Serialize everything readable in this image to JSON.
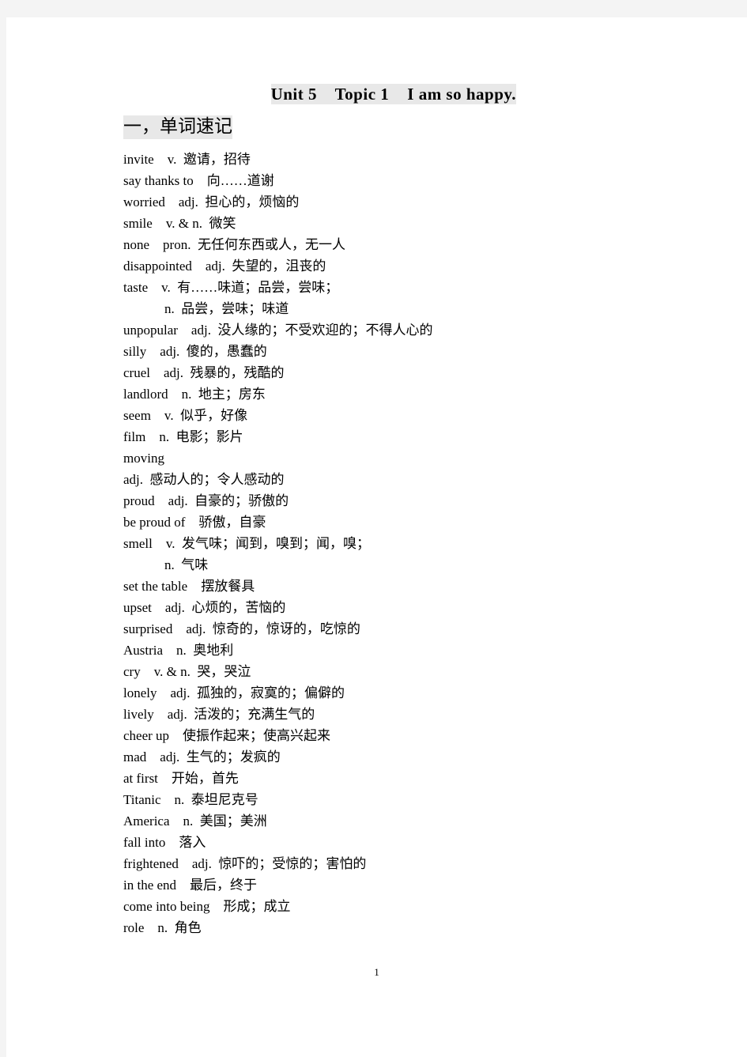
{
  "document": {
    "title": "Unit 5    Topic 1    I am so happy.",
    "section_heading": "一，单词速记",
    "page_number": "1",
    "highlight_color": "#e8e8e8",
    "page_background": "#ffffff",
    "canvas_background": "#f4f4f4"
  },
  "vocabulary": [
    {
      "text": "invite    v.  邀请，招待",
      "continuation": false
    },
    {
      "text": "say thanks to    向……道谢",
      "continuation": false
    },
    {
      "text": "worried    adj.  担心的，烦恼的",
      "continuation": false
    },
    {
      "text": "smile    v. & n.  微笑",
      "continuation": false
    },
    {
      "text": "none    pron.  无任何东西或人，无一人",
      "continuation": false
    },
    {
      "text": "disappointed    adj.  失望的，沮丧的",
      "continuation": false
    },
    {
      "text": "taste    v.  有……味道；品尝，尝味；",
      "continuation": false
    },
    {
      "text": "n.  品尝，尝味；味道",
      "continuation": true
    },
    {
      "text": "unpopular    adj.  没人缘的；不受欢迎的；不得人心的",
      "continuation": false
    },
    {
      "text": "silly    adj.  傻的，愚蠢的",
      "continuation": false
    },
    {
      "text": "cruel    adj.  残暴的，残酷的",
      "continuation": false
    },
    {
      "text": "landlord    n.  地主；房东",
      "continuation": false
    },
    {
      "text": "seem    v.  似乎，好像",
      "continuation": false
    },
    {
      "text": "film    n.  电影；影片",
      "continuation": false
    },
    {
      "text": "moving",
      "continuation": false
    },
    {
      "text": "adj.  感动人的；令人感动的",
      "continuation": false
    },
    {
      "text": "proud    adj.  自豪的；骄傲的",
      "continuation": false
    },
    {
      "text": "be proud of    骄傲，自豪",
      "continuation": false
    },
    {
      "text": "smell    v.  发气味；闻到，嗅到；闻，嗅；",
      "continuation": false
    },
    {
      "text": "n.  气味",
      "continuation": true
    },
    {
      "text": "set the table    摆放餐具",
      "continuation": false
    },
    {
      "text": "upset    adj.  心烦的，苦恼的",
      "continuation": false
    },
    {
      "text": "surprised    adj.  惊奇的，惊讶的，吃惊的",
      "continuation": false
    },
    {
      "text": "Austria    n.  奥地利",
      "continuation": false
    },
    {
      "text": "cry    v. & n.  哭，哭泣",
      "continuation": false
    },
    {
      "text": "lonely    adj.  孤独的，寂寞的；偏僻的",
      "continuation": false
    },
    {
      "text": "lively    adj.  活泼的；充满生气的",
      "continuation": false
    },
    {
      "text": "cheer up    使振作起来；使高兴起来",
      "continuation": false
    },
    {
      "text": "mad    adj.  生气的；发疯的",
      "continuation": false
    },
    {
      "text": "at first    开始，首先",
      "continuation": false
    },
    {
      "text": "Titanic    n.  泰坦尼克号",
      "continuation": false
    },
    {
      "text": "America    n.  美国；美洲",
      "continuation": false
    },
    {
      "text": "fall into    落入",
      "continuation": false
    },
    {
      "text": "frightened    adj.  惊吓的；受惊的；害怕的",
      "continuation": false
    },
    {
      "text": "in the end    最后，终于",
      "continuation": false
    },
    {
      "text": "come into being    形成；成立",
      "continuation": false
    },
    {
      "text": "role    n.  角色",
      "continuation": false
    }
  ]
}
